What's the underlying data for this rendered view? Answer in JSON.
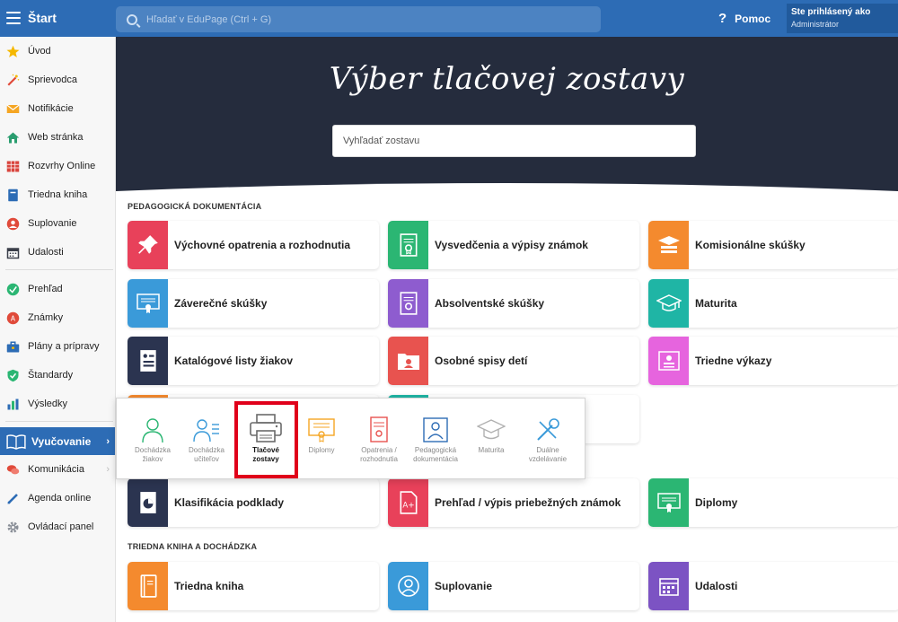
{
  "topbar": {
    "start_label": "Štart",
    "search_placeholder": "Hľadať v EduPage (Ctrl + G)",
    "help_label": "Pomoc",
    "user_line1": "Ste prihlásený ako",
    "user_line2": "Administrátor",
    "bar_color": "#2d6cb5"
  },
  "sidebar": {
    "items": [
      {
        "label": "Úvod",
        "icon": "star-icon"
      },
      {
        "label": "Sprievodca",
        "icon": "magic-wand-icon"
      },
      {
        "label": "Notifikácie",
        "icon": "envelope-icon"
      },
      {
        "label": "Web stránka",
        "icon": "house-icon"
      },
      {
        "label": "Rozvrhy Online",
        "icon": "timetable-grid-icon"
      },
      {
        "label": "Triedna kniha",
        "icon": "book-icon"
      },
      {
        "label": "Suplovanie",
        "icon": "person-icon"
      },
      {
        "label": "Udalosti",
        "icon": "calendar-icon"
      },
      {
        "label": "Prehľad",
        "icon": "check-circle-icon"
      },
      {
        "label": "Známky",
        "icon": "grade-badge-icon"
      },
      {
        "label": "Plány a prípravy",
        "icon": "briefcase-icon"
      },
      {
        "label": "Štandardy",
        "icon": "shield-icon"
      },
      {
        "label": "Výsledky",
        "icon": "bar-chart-icon"
      },
      {
        "label": "Vyučovanie",
        "icon": "open-book-icon"
      },
      {
        "label": "Komunikácia",
        "icon": "chat-bubbles-icon"
      },
      {
        "label": "Agenda online",
        "icon": "pen-icon"
      },
      {
        "label": "Ovládací panel",
        "icon": "gear-icon"
      }
    ]
  },
  "hero": {
    "title": "Výber tlačovej zostavy",
    "search_placeholder": "Vyhľadať zostavu"
  },
  "sections": {
    "pedagogicka": "PEDAGOGICKÁ DOKUMENTÁCIA",
    "triedna": "TRIEDNA KNIHA A DOCHÁDZKA"
  },
  "cards": {
    "row1": [
      "Výchovné opatrenia a rozhodnutia",
      "Vysvedčenia a výpisy známok",
      "Komisionálne skúšky"
    ],
    "row2": [
      "Záverečné skúšky",
      "Absolventské skúšky",
      "Maturita"
    ],
    "row3": [
      "Katalógové listy žiakov",
      "Osobné spisy detí",
      "Triedne výkazy"
    ],
    "row5": [
      "Klasifikácia podklady",
      "Prehľad / výpis priebežných známok",
      "Diplomy"
    ],
    "row6": [
      "Triedna kniha",
      "Suplovanie",
      "Udalosti"
    ]
  },
  "popup": {
    "items": [
      {
        "l1": "Dochádzka",
        "l2": "žiakov"
      },
      {
        "l1": "Dochádzka",
        "l2": "učiteľov"
      },
      {
        "l1": "Tlačové",
        "l2": "zostavy"
      },
      {
        "l1": "Diplomy",
        "l2": ""
      },
      {
        "l1": "Opatrenia /",
        "l2": "rozhodnutia"
      },
      {
        "l1": "Pedagogická",
        "l2": "dokumentácia"
      },
      {
        "l1": "Maturita",
        "l2": ""
      },
      {
        "l1": "Duálne",
        "l2": "vzdelávanie"
      }
    ]
  },
  "colors": {
    "red": "#e8415a",
    "green": "#2bb673",
    "orange": "#f48a2e",
    "blue": "#3a9ad9",
    "purple": "#8e5ccf",
    "teal": "#1fb5a5",
    "navy": "#2b3450",
    "coral": "#e8534f",
    "pink": "#e664de",
    "violet": "#7c53c3"
  }
}
